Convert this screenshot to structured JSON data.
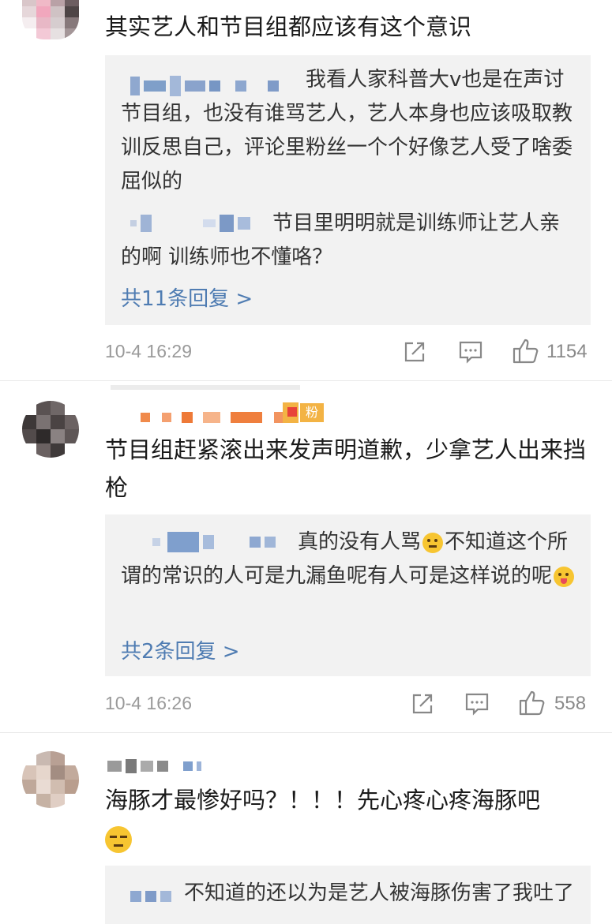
{
  "comments": [
    {
      "text": "其实艺人和节目组都应该有这个意识",
      "replies": [
        {
          "text": "我看人家科普大v也是在声讨节目组，也没有谁骂艺人，艺人本身也应该吸取教训反思自己，评论里粉丝一个个好像艺人受了啥委屈似的"
        },
        {
          "text": "节目里明明就是训练师让艺人亲的啊 训练师也不懂咯？"
        }
      ],
      "more": "共11条回复 >",
      "time": "10-4 16:29",
      "likes": "1154"
    },
    {
      "text": "节目组赶紧滚出来发声明道歉，少拿艺人出来挡枪",
      "badge": "粉",
      "replies": [
        {
          "text": "真的没有人骂",
          "text2": "不知道这个所谓的常识的人可是九漏鱼呢有人可是这样说的呢"
        }
      ],
      "more": "共2条回复 >",
      "time": "10-4 16:26",
      "likes": "558"
    },
    {
      "text": "海豚才最惨好吗？！！！先心疼心疼海豚吧",
      "replies": [
        {
          "text": "不知道的还以为是艺人被海豚伤害了我",
          "text2": "吐了"
        }
      ]
    }
  ],
  "icons": {
    "share": "share-icon",
    "comment": "comment-icon",
    "like": "thumbs-up-icon",
    "emoji_thinking": "thinking-emoji-icon",
    "emoji_tongue": "tongue-emoji-icon",
    "emoji_smirk": "smirk-emoji-icon"
  },
  "colors": {
    "link": "#4f7cb2",
    "reply_bg": "#f2f2f2",
    "meta": "#9a9a9a"
  }
}
